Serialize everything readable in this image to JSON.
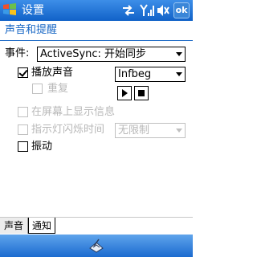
{
  "titlebar": {
    "title": "设置",
    "ok_label": "ok",
    "icons": [
      "windows-start-icon",
      "connectivity-icon",
      "signal-icon",
      "volume-icon"
    ]
  },
  "header": {
    "title": "声音和提醒"
  },
  "event": {
    "label": "事件:",
    "selected": "ActiveSync: 开始同步"
  },
  "options": {
    "play_sound": {
      "label": "播放声音",
      "checked": true
    },
    "sound_file": "Infbeg",
    "repeat": {
      "label": "重复",
      "checked": false,
      "enabled": false
    },
    "show_message": {
      "label": "在屏幕上显示信息",
      "checked": false,
      "enabled": false
    },
    "flash_light": {
      "label": "指示灯闪烁时间",
      "checked": false,
      "enabled": false
    },
    "flash_duration": "无限制",
    "vibrate": {
      "label": "振动",
      "checked": false
    }
  },
  "tabs": [
    {
      "label": "声音",
      "active": false
    },
    {
      "label": "通知",
      "active": true
    }
  ],
  "colors": {
    "titlebar": "#1162c8",
    "header_text": "#1766c4",
    "disabled_text": "#b8b8b8"
  }
}
